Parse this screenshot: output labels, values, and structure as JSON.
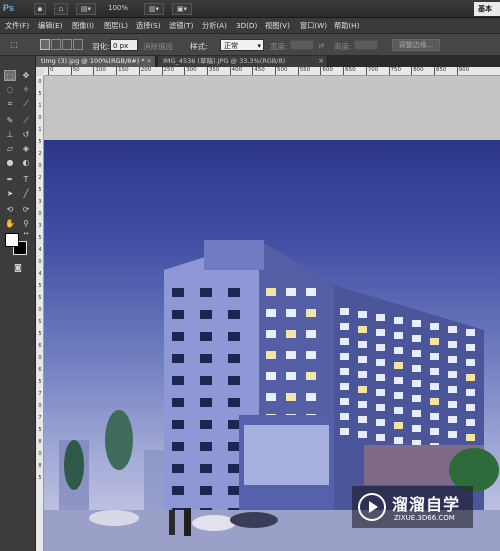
{
  "app": {
    "logo": "Ps",
    "zoom": "100%",
    "workspace": "基本"
  },
  "menu": [
    "文件(F)",
    "编辑(E)",
    "图像(I)",
    "图层(L)",
    "选择(S)",
    "滤镜(T)",
    "分析(A)",
    "3D(D)",
    "视图(V)",
    "窗口(W)",
    "帮助(H)"
  ],
  "options": {
    "feather_label": "羽化:",
    "feather_value": "0 px",
    "antialias_label": "消除锯齿",
    "style_label": "样式:",
    "style_value": "正常",
    "width_label": "宽度:",
    "height_label": "高度:",
    "refine_edge": "调整边缘..."
  },
  "tabs": [
    {
      "label": "timg (3).jpg @ 100%(RGB/8#) *",
      "active": true
    },
    {
      "label": "IMG_4536 (草稿).JPG @ 33.3%(RGB/8)",
      "active": false
    }
  ],
  "ruler": {
    "h_ticks": [
      "0",
      "50",
      "100",
      "150",
      "200",
      "250",
      "300",
      "350",
      "400",
      "450",
      "500",
      "550",
      "600",
      "650",
      "700",
      "750",
      "800",
      "850",
      "900"
    ],
    "v_ticks": [
      "0",
      "5",
      "1",
      "0",
      "1",
      "5",
      "2",
      "0",
      "2",
      "5",
      "3",
      "0",
      "3",
      "5",
      "4",
      "0",
      "4",
      "5",
      "5",
      "0",
      "5",
      "5",
      "6",
      "0",
      "6",
      "5",
      "7",
      "0",
      "7",
      "5",
      "8",
      "0",
      "8",
      "5"
    ]
  },
  "colors": {
    "foreground": "#ffffff",
    "background": "#000000",
    "sky_top": "#2b3688",
    "building": "#6f7bc3"
  },
  "watermark": {
    "title": "溜溜自学",
    "subtitle": "ZIXUE.3D66.COM"
  },
  "icons": {
    "tools": [
      "marquee",
      "move",
      "lasso",
      "magic-wand",
      "crop",
      "eyedropper",
      "healing-brush",
      "brush",
      "clone-stamp",
      "history-brush",
      "eraser",
      "gradient",
      "blur",
      "dodge",
      "pen",
      "type",
      "path-selection",
      "shape",
      "3d-rotate",
      "3d-camera",
      "hand",
      "zoom"
    ]
  }
}
